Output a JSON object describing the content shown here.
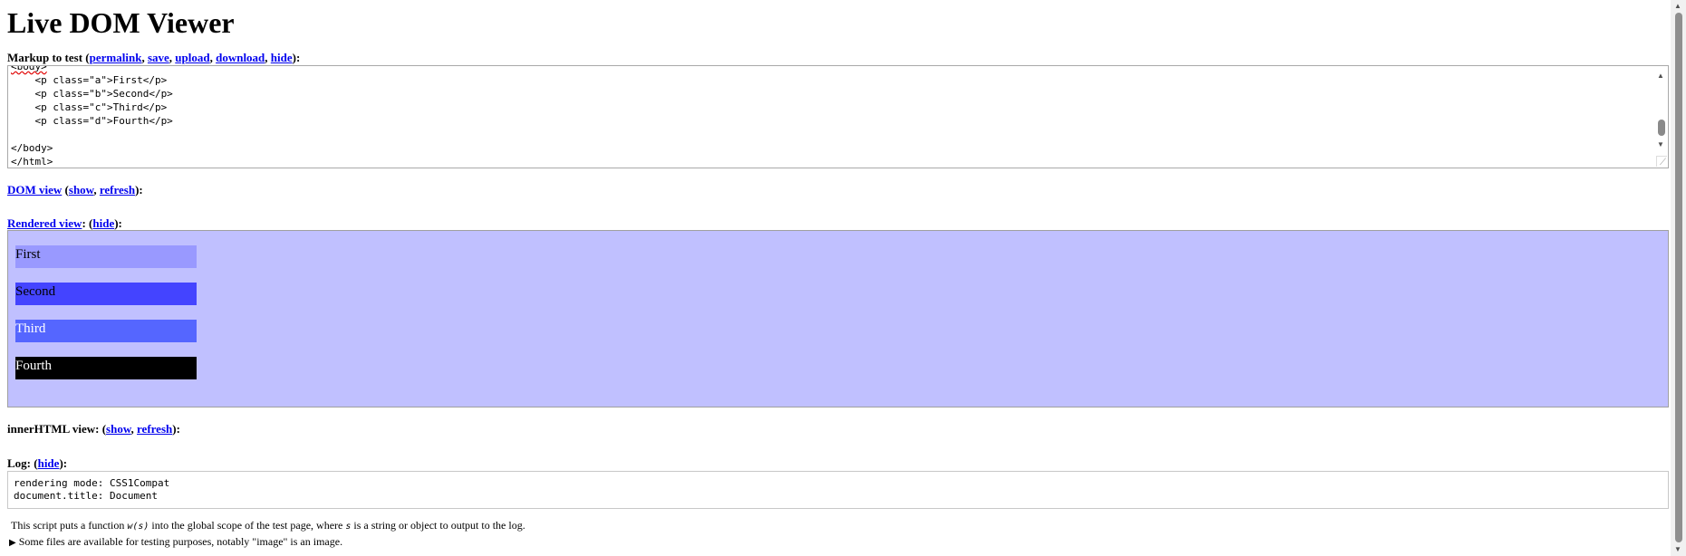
{
  "title": "Live DOM Viewer",
  "markup_section": {
    "label": "Markup to test (",
    "links": [
      "permalink",
      "save",
      "upload",
      "download",
      "hide"
    ],
    "suffix": "):",
    "code_lines": [
      "<body>",
      "    <p class=\"a\">First</p>",
      "    <p class=\"b\">Second</p>",
      "    <p class=\"c\">Third</p>",
      "    <p class=\"d\">Fourth</p>",
      "",
      "</body>",
      "</html>"
    ]
  },
  "dom_view": {
    "title_link": "DOM view",
    "mid": " (",
    "links": [
      "show",
      "refresh"
    ],
    "suffix": "):"
  },
  "rendered_view": {
    "title_link": "Rendered view",
    "mid": ": (",
    "link": "hide",
    "suffix": "):",
    "paragraphs": [
      "First",
      "Second",
      "Third",
      "Fourth"
    ],
    "background": "#c0c0ff",
    "colors": {
      "a": "#9999ff",
      "b": "#4444ff",
      "c": "#5566ff",
      "d": "#000000"
    }
  },
  "innerhtml_view": {
    "label": "innerHTML view: (",
    "links": [
      "show",
      "refresh"
    ],
    "suffix": "):"
  },
  "log": {
    "label": "Log: (",
    "link": "hide",
    "suffix": "):",
    "lines": [
      "rendering mode: CSS1Compat",
      "document.title: Document"
    ]
  },
  "notes": {
    "script_pre": "This script puts a function ",
    "script_fn": "w(s)",
    "script_mid": " into the global scope of the test page, where ",
    "script_var": "s",
    "script_post": " is a string or object to output to the log.",
    "files": "Some files are available for testing purposes, notably \"image\" is an image."
  },
  "icons": {
    "disclosure": "triangle-right-icon",
    "scroll_up": "chevron-up-icon",
    "scroll_down": "chevron-down-icon",
    "resize": "resize-grip-icon"
  }
}
